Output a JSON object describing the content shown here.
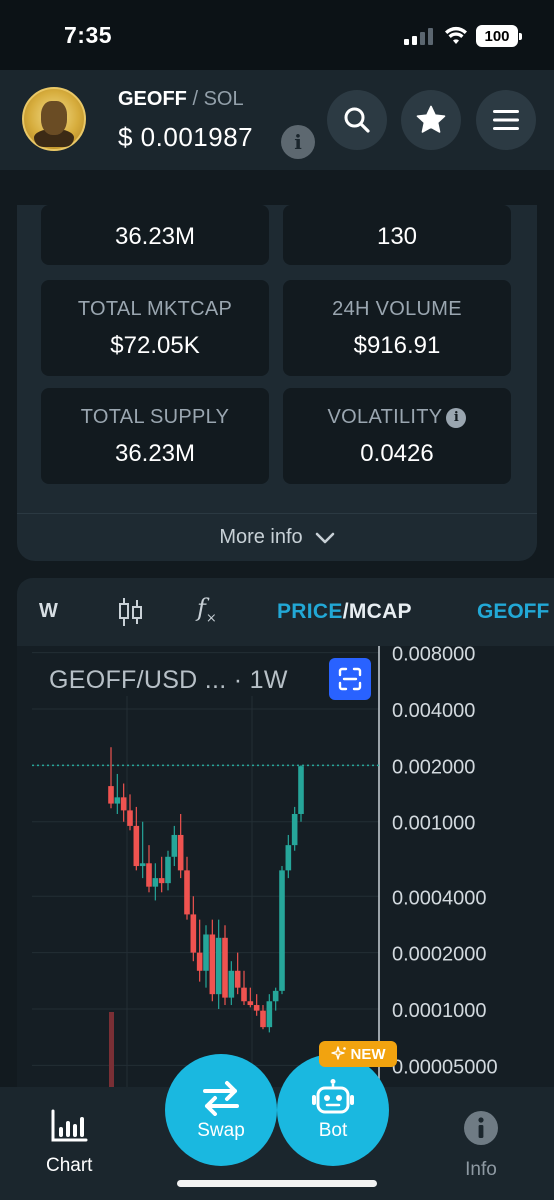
{
  "status_bar": {
    "time": "7:35",
    "battery": "100"
  },
  "header": {
    "base": "GEOFF",
    "separator": "/",
    "quote": "SOL",
    "price": "$ 0.001987",
    "info_glyph": "i"
  },
  "stats": {
    "row0": [
      {
        "value": "36.23M"
      },
      {
        "value": "130"
      }
    ],
    "rows": [
      [
        {
          "label": "TOTAL MKTCAP",
          "value": "$72.05K"
        },
        {
          "label": "24H VOLUME",
          "value": "$916.91"
        }
      ],
      [
        {
          "label": "TOTAL SUPPLY",
          "value": "36.23M"
        },
        {
          "label": "VOLATILITY",
          "value": "0.0426"
        }
      ]
    ],
    "more_info": "More info"
  },
  "chart_toolbar": {
    "interval": "W",
    "price_label": "PRICE",
    "sep": "/",
    "mcap_label": "MCAP",
    "token_tab": "GEOFF"
  },
  "chart_data": {
    "type": "candlestick",
    "title": "GEOFF/USD ... · 1W",
    "yscale": "log",
    "y_ticks": [
      "0.008000",
      "0.004000",
      "0.002000",
      "0.001000",
      "0.0004000",
      "0.0002000",
      "0.0001000",
      "0.00005000"
    ],
    "current_price_line": 0.002,
    "candles": [
      {
        "o": 0.00155,
        "h": 0.0025,
        "l": 0.00118,
        "c": 0.00125
      },
      {
        "o": 0.00125,
        "h": 0.0018,
        "l": 0.0011,
        "c": 0.00135
      },
      {
        "o": 0.00135,
        "h": 0.0016,
        "l": 0.001,
        "c": 0.00115
      },
      {
        "o": 0.00115,
        "h": 0.0014,
        "l": 0.0009,
        "c": 0.00095
      },
      {
        "o": 0.00095,
        "h": 0.0012,
        "l": 0.00055,
        "c": 0.00058
      },
      {
        "o": 0.00058,
        "h": 0.001,
        "l": 0.0005,
        "c": 0.0006
      },
      {
        "o": 0.0006,
        "h": 0.00075,
        "l": 0.00042,
        "c": 0.00045
      },
      {
        "o": 0.00045,
        "h": 0.0006,
        "l": 0.00038,
        "c": 0.0005
      },
      {
        "o": 0.0005,
        "h": 0.00065,
        "l": 0.00042,
        "c": 0.00047
      },
      {
        "o": 0.00047,
        "h": 0.0007,
        "l": 0.00043,
        "c": 0.00065
      },
      {
        "o": 0.00065,
        "h": 0.00095,
        "l": 0.00058,
        "c": 0.00085
      },
      {
        "o": 0.00085,
        "h": 0.0011,
        "l": 0.0005,
        "c": 0.00055
      },
      {
        "o": 0.00055,
        "h": 0.00065,
        "l": 0.0003,
        "c": 0.00032
      },
      {
        "o": 0.00032,
        "h": 0.0004,
        "l": 0.00018,
        "c": 0.0002
      },
      {
        "o": 0.0002,
        "h": 0.0003,
        "l": 0.00014,
        "c": 0.00016
      },
      {
        "o": 0.00016,
        "h": 0.00028,
        "l": 0.00013,
        "c": 0.00025
      },
      {
        "o": 0.00025,
        "h": 0.0003,
        "l": 0.00011,
        "c": 0.00012
      },
      {
        "o": 0.00012,
        "h": 0.0003,
        "l": 0.0001,
        "c": 0.00024
      },
      {
        "o": 0.00024,
        "h": 0.00028,
        "l": 0.000105,
        "c": 0.000115
      },
      {
        "o": 0.000115,
        "h": 0.00018,
        "l": 0.000105,
        "c": 0.00016
      },
      {
        "o": 0.00016,
        "h": 0.0002,
        "l": 0.00012,
        "c": 0.00013
      },
      {
        "o": 0.00013,
        "h": 0.00016,
        "l": 0.000105,
        "c": 0.00011
      },
      {
        "o": 0.00011,
        "h": 0.00013,
        "l": 0.000102,
        "c": 0.000105
      },
      {
        "o": 0.000105,
        "h": 0.00012,
        "l": 9.2e-05,
        "c": 9.8e-05
      },
      {
        "o": 9.8e-05,
        "h": 0.000105,
        "l": 7.8e-05,
        "c": 8e-05
      },
      {
        "o": 8e-05,
        "h": 0.00012,
        "l": 7.5e-05,
        "c": 0.00011
      },
      {
        "o": 0.00011,
        "h": 0.00013,
        "l": 9.8e-05,
        "c": 0.000125
      },
      {
        "o": 0.000125,
        "h": 0.00058,
        "l": 0.00012,
        "c": 0.00055
      },
      {
        "o": 0.00055,
        "h": 0.00085,
        "l": 0.0005,
        "c": 0.00075
      },
      {
        "o": 0.00075,
        "h": 0.0012,
        "l": 0.0007,
        "c": 0.0011
      },
      {
        "o": 0.0011,
        "h": 0.002,
        "l": 0.001,
        "c": 0.00198
      }
    ],
    "colors": {
      "up": "#26a69a",
      "down": "#ef5350",
      "price_line": "#26a69a"
    }
  },
  "bottom_nav": {
    "chart": "Chart",
    "swap": "Swap",
    "bot": "Bot",
    "info": "Info",
    "new_badge": "NEW"
  },
  "icons": {
    "search": "search-icon",
    "star": "star-icon",
    "menu": "menu-icon",
    "chevron": "chevron-down-icon"
  }
}
